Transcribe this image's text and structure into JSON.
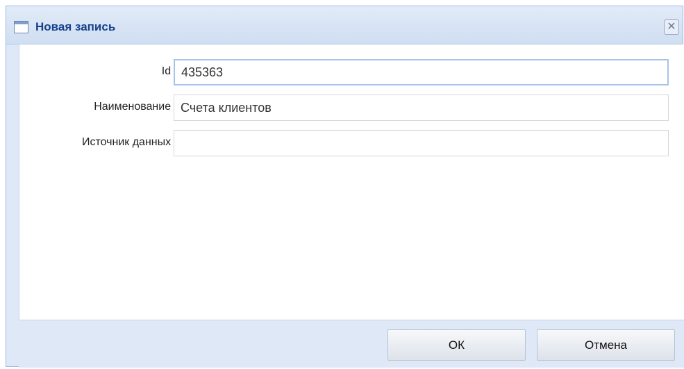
{
  "dialog": {
    "title": "Новая запись",
    "close_icon": "close-icon"
  },
  "form": {
    "fields": [
      {
        "label": "Id :",
        "value": "435363"
      },
      {
        "label": "Наименование :",
        "value": "Счета клиентов"
      },
      {
        "label": "Источник данных :",
        "value": ""
      }
    ]
  },
  "footer": {
    "ok_label": "ОК",
    "cancel_label": "Отмена"
  }
}
